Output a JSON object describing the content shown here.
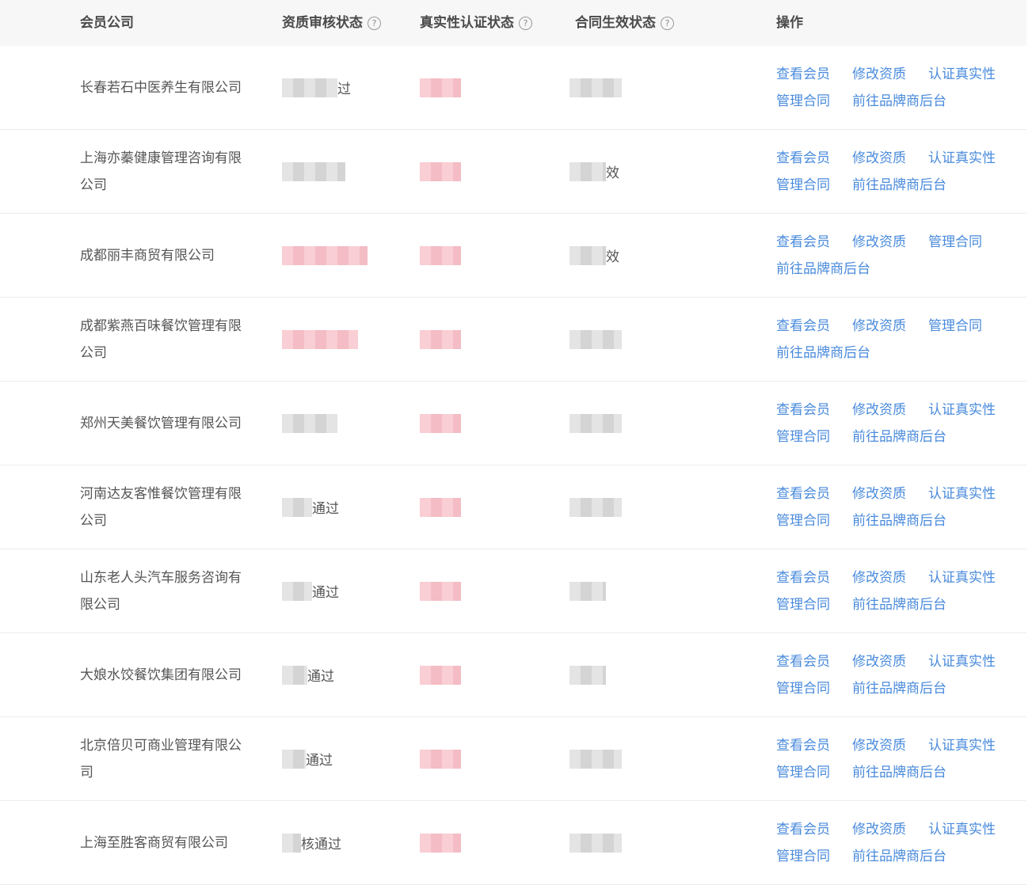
{
  "table": {
    "headers": {
      "company": "会员公司",
      "qualification": "资质审核状态",
      "authenticity": "真实性认证状态",
      "contract": "合同生效状态",
      "actions": "操作"
    },
    "help_icon": "question-circle-icon",
    "rows": [
      {
        "company_lines": [
          "长春若石中医养生有限公司"
        ],
        "qualification": "过",
        "authenticity": "",
        "contract": "",
        "actions_line1": [
          "查看会员",
          "修改资质",
          "认证真实性"
        ],
        "actions_line2": [
          "管理合同",
          "前往品牌商后台"
        ]
      },
      {
        "company_lines": [
          "上海亦蓁健康管理咨询有限",
          "公司"
        ],
        "qualification": "",
        "authenticity": "",
        "contract": "效",
        "actions_line1": [
          "查看会员",
          "修改资质",
          "认证真实性"
        ],
        "actions_line2": [
          "管理合同",
          "前往品牌商后台"
        ]
      },
      {
        "company_lines": [
          "成都丽丰商贸有限公司"
        ],
        "qualification": "",
        "authenticity": "",
        "contract": "效",
        "actions_line1": [
          "查看会员",
          "修改资质",
          "管理合同"
        ],
        "actions_line2": [
          "前往品牌商后台"
        ]
      },
      {
        "company_lines": [
          "成都紫燕百味餐饮管理有限",
          "公司"
        ],
        "qualification": "",
        "authenticity": "",
        "contract": "",
        "actions_line1": [
          "查看会员",
          "修改资质",
          "管理合同"
        ],
        "actions_line2": [
          "前往品牌商后台"
        ]
      },
      {
        "company_lines": [
          "郑州天美餐饮管理有限公司"
        ],
        "qualification": "",
        "authenticity": "",
        "contract": "",
        "actions_line1": [
          "查看会员",
          "修改资质",
          "认证真实性"
        ],
        "actions_line2": [
          "管理合同",
          "前往品牌商后台"
        ]
      },
      {
        "company_lines": [
          "河南达友客惟餐饮管理有限",
          "公司"
        ],
        "qualification": "通过",
        "authenticity": "",
        "contract": "",
        "actions_line1": [
          "查看会员",
          "修改资质",
          "认证真实性"
        ],
        "actions_line2": [
          "管理合同",
          "前往品牌商后台"
        ]
      },
      {
        "company_lines": [
          "山东老人头汽车服务咨询有",
          "限公司"
        ],
        "qualification": "通过",
        "authenticity": "",
        "contract": "",
        "actions_line1": [
          "查看会员",
          "修改资质",
          "认证真实性"
        ],
        "actions_line2": [
          "管理合同",
          "前往品牌商后台"
        ]
      },
      {
        "company_lines": [
          "大娘水饺餐饮集团有限公司"
        ],
        "qualification": "通过",
        "authenticity": "",
        "contract": "",
        "actions_line1": [
          "查看会员",
          "修改资质",
          "认证真实性"
        ],
        "actions_line2": [
          "管理合同",
          "前往品牌商后台"
        ]
      },
      {
        "company_lines": [
          "北京倍贝可商业管理有限公",
          "司"
        ],
        "qualification": "通过",
        "authenticity": "",
        "contract": "",
        "actions_line1": [
          "查看会员",
          "修改资质",
          "认证真实性"
        ],
        "actions_line2": [
          "管理合同",
          "前往品牌商后台"
        ]
      },
      {
        "company_lines": [
          "上海至胜客商贸有限公司"
        ],
        "qualification": "核通过",
        "authenticity": "",
        "contract": "",
        "actions_line1": [
          "查看会员",
          "修改资质",
          "认证真实性"
        ],
        "actions_line2": [
          "管理合同",
          "前往品牌商后台"
        ]
      }
    ]
  },
  "colors": {
    "link": "#4a8bdc",
    "header_bg": "#f7f7f8",
    "text": "#555555",
    "mosaic_gray": "#d8d8d8",
    "mosaic_pink": "#f5bcc4"
  }
}
